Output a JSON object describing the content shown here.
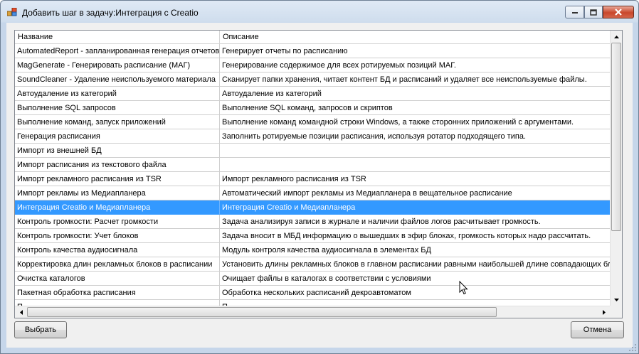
{
  "window": {
    "title": "Добавить шаг в задачу:Интеграция с Creatio"
  },
  "table": {
    "columns": [
      "Название",
      "Описание"
    ],
    "rows": [
      {
        "name": "AutomatedReport - запланированная генерация отчетов",
        "description": "Генерирует отчеты по расписанию"
      },
      {
        "name": "MagGenerate - Генерировать расписание (МАГ)",
        "description": "Генерирование содержимое для всех ротируемых позиций МАГ."
      },
      {
        "name": "SoundCleaner - Удаление неиспользуемого материала",
        "description": "Сканирует папки хранения, читает контент БД и расписаний и удаляет все неиспользуемые файлы."
      },
      {
        "name": "Автоудаление из категорий",
        "description": "Автоудаление из категорий"
      },
      {
        "name": "Выполнение SQL запросов",
        "description": "Выполнение SQL команд, запросов и скриптов"
      },
      {
        "name": "Выполнение команд, запуск приложений",
        "description": "Выполнение команд командной строки Windows, а также сторонних приложений с аргументами."
      },
      {
        "name": "Генерация расписания",
        "description": "Заполнить ротируемые позиции расписания, используя ротатор подходящего типа."
      },
      {
        "name": "Импорт из внешней БД",
        "description": ""
      },
      {
        "name": "Импорт расписания из текстового файла",
        "description": ""
      },
      {
        "name": "Импорт рекламного расписания из TSR",
        "description": "Импорт рекламного расписания из TSR"
      },
      {
        "name": "Импорт рекламы из Медиапланера",
        "description": "Автоматический импорт рекламы из Медиапланера в вещательное расписание"
      },
      {
        "name": "Интеграция Creatio и Медиапланера",
        "description": "Интеграция Creatio и Медиапланера"
      },
      {
        "name": "Контроль громкости: Расчет громкости",
        "description": "Задача анализируя записи в журнале и наличии файлов логов расчитывает громкость."
      },
      {
        "name": "Контроль громкости: Учет блоков",
        "description": "Задача вносит в МБД информацию о вышедших в эфир блоках, громкость которых надо рассчитать."
      },
      {
        "name": "Контроль качества аудиосигнала",
        "description": "Модуль контроля качества аудиосигнала в элементах БД"
      },
      {
        "name": "Корректировка длин рекламных блоков в расписании",
        "description": "Установить длины рекламных блоков в главном расписании равными наибольшей длине совпадающих блоков"
      },
      {
        "name": "Очистка каталогов",
        "description": "Очищает файлы в каталогах в соответствии с условиями"
      },
      {
        "name": "Пакетная обработка расписания",
        "description": "Обработка нескольких расписаний декроавтоматом"
      },
      {
        "name": "П",
        "description": "П"
      }
    ],
    "selected_row": 11
  },
  "buttons": {
    "select": "Выбрать",
    "cancel": "Отмена"
  },
  "colors": {
    "selection": "#3399ff",
    "close_button": "#c9462b"
  },
  "icons": {
    "app": "app-icon",
    "minimize": "minimize-icon",
    "maximize": "maximize-icon",
    "close": "close-icon"
  }
}
